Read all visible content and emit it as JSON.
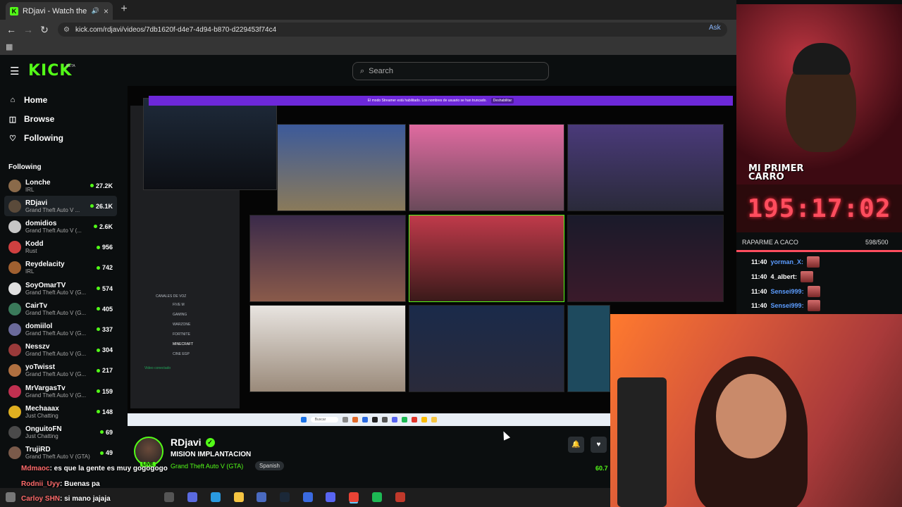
{
  "browser": {
    "tab_title": "RDjavi - Watch the VOD on",
    "tab_favicon": "K",
    "new_tab": "+",
    "url": "kick.com/rdjavi/videos/7db1620f-d4e7-4d94-b870-d229453f74c4",
    "ask_label": "Ask"
  },
  "kick": {
    "logo": "KICK",
    "beta": "BETA",
    "search_placeholder": "Search",
    "nav": [
      {
        "label": "Home",
        "icon": "home-icon"
      },
      {
        "label": "Browse",
        "icon": "compass-icon"
      },
      {
        "label": "Following",
        "icon": "heart-icon"
      }
    ],
    "following_header": "Following",
    "channels": [
      {
        "name": "Lonche",
        "game": "IRL",
        "viewers": "27.2K",
        "color": "#8a6a4a"
      },
      {
        "name": "RDjavi",
        "game": "Grand Theft Auto V ...",
        "viewers": "26.1K",
        "color": "#5a4a3a"
      },
      {
        "name": "domidios",
        "game": "Grand Theft Auto V (...",
        "viewers": "2.6K",
        "color": "#c6c6c6"
      },
      {
        "name": "Kodd",
        "game": "Rust",
        "viewers": "956",
        "color": "#d04040"
      },
      {
        "name": "Reydelacity",
        "game": "IRL",
        "viewers": "742",
        "color": "#a06030"
      },
      {
        "name": "SoyOmarTV",
        "game": "Grand Theft Auto V (G...",
        "viewers": "574",
        "color": "#e0e0e0"
      },
      {
        "name": "CairTv",
        "game": "Grand Theft Auto V (G...",
        "viewers": "405",
        "color": "#3a7a5a"
      },
      {
        "name": "domiilol",
        "game": "Grand Theft Auto V (G...",
        "viewers": "337",
        "color": "#6a6a9a"
      },
      {
        "name": "Nesszv",
        "game": "Grand Theft Auto V (G...",
        "viewers": "304",
        "color": "#9a3a3a"
      },
      {
        "name": "yoTwisst",
        "game": "Grand Theft Auto V (G...",
        "viewers": "217",
        "color": "#b07040"
      },
      {
        "name": "MrVargasTv",
        "game": "Grand Theft Auto V (G...",
        "viewers": "159",
        "color": "#c03050"
      },
      {
        "name": "Mechaaax",
        "game": "Just Chatting",
        "viewers": "148",
        "color": "#e0b020"
      },
      {
        "name": "OnguitoFN",
        "game": "Just Chatting",
        "viewers": "69",
        "color": "#4a4a4a"
      },
      {
        "name": "TrujiRD",
        "game": "Grand Theft Auto V (GTA)",
        "viewers": "49",
        "color": "#7a5a4a"
      }
    ]
  },
  "video": {
    "streamer_mode_text": "El modo Streamer está habilitado. Los nombres de usuario se han truncado.",
    "streamer_mode_button": "Deshabilitar",
    "discord_channels": [
      "CANALES DE VOZ",
      "FIVE M",
      "GAMING",
      "WARZONE",
      "FORTNITE",
      "MINECRAFT",
      "CINE EGP"
    ],
    "discord_status": "Video conectado",
    "inner_taskbar_search": "Buscar"
  },
  "stream": {
    "name": "RDjavi",
    "title": "MISION IMPLANTACION",
    "category": "Grand Theft Auto V (GTA)",
    "language": "Spanish",
    "live_badge": "LIVE",
    "viewers": "60.7",
    "verified_icon": "✓"
  },
  "chat_overlay": [
    {
      "user": "Mdmaoc",
      "text": ": es que la gente es muy gogogogo"
    },
    {
      "user": "Rodnii_Uyy",
      "text": ": Buenas pa"
    },
    {
      "user": "Carloy SHN",
      "text": ": si mano jajaja"
    }
  ],
  "overlay": {
    "banner": "MI PRIMER CARRO",
    "timer": "195:17:02",
    "goal_label": "RAPARME A CACO",
    "goal_count": "598/500",
    "goal_fraction": 1.0,
    "chat": [
      {
        "time": "11:40",
        "user": "yorman_X:",
        "color": "#5b9cff"
      },
      {
        "time": "11:40",
        "user": "4_albert:",
        "color": "#ffffff"
      },
      {
        "time": "11:40",
        "user": "Sensei999:",
        "color": "#5b9cff"
      },
      {
        "time": "11:40",
        "user": "Sensei999:",
        "color": "#5b9cff"
      }
    ]
  },
  "colors": {
    "kick_green": "#53fc18",
    "timer_red": "#ff4d5e",
    "banner_purple": "#6d28d9"
  }
}
